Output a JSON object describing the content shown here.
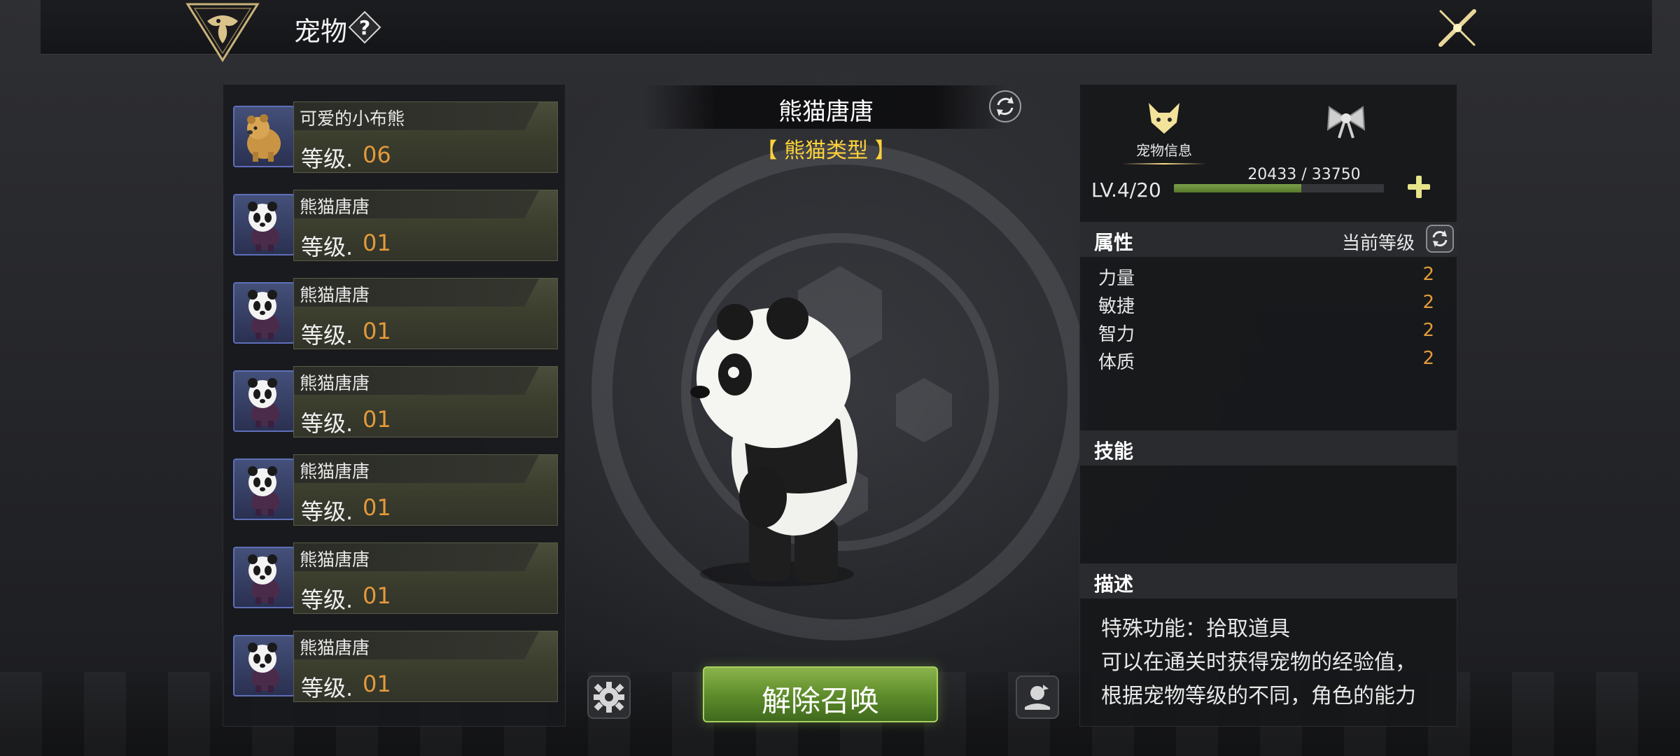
{
  "header": {
    "title": "宠物",
    "help_symbol": "?"
  },
  "pet_list": [
    {
      "name": "可爱的小布熊",
      "level_label": "等级.",
      "level": "06",
      "type": "bear"
    },
    {
      "name": "熊猫唐唐",
      "level_label": "等级.",
      "level": "01",
      "type": "panda"
    },
    {
      "name": "熊猫唐唐",
      "level_label": "等级.",
      "level": "01",
      "type": "panda"
    },
    {
      "name": "熊猫唐唐",
      "level_label": "等级.",
      "level": "01",
      "type": "panda"
    },
    {
      "name": "熊猫唐唐",
      "level_label": "等级.",
      "level": "01",
      "type": "panda"
    },
    {
      "name": "熊猫唐唐",
      "level_label": "等级.",
      "level": "01",
      "type": "panda"
    },
    {
      "name": "熊猫唐唐",
      "level_label": "等级.",
      "level": "01",
      "type": "panda"
    }
  ],
  "selected_pet": {
    "name": "熊猫唐唐",
    "type_label": "【 熊猫类型 】"
  },
  "actions": {
    "dismiss_label": "解除召唤"
  },
  "info": {
    "tabs": [
      {
        "label": "宠物信息",
        "icon": "fox-head-icon",
        "active": true
      },
      {
        "label": "",
        "icon": "bow-icon",
        "active": false
      }
    ],
    "level_text": "LV.4/20",
    "exp_text": "20433 / 33750",
    "exp_fraction": 0.605,
    "attributes_title": "属性",
    "current_level_label": "当前等级",
    "attributes": [
      {
        "name": "力量",
        "value": "2"
      },
      {
        "name": "敏捷",
        "value": "2"
      },
      {
        "name": "智力",
        "value": "2"
      },
      {
        "name": "体质",
        "value": "2"
      }
    ],
    "skills_title": "技能",
    "description_title": "描述",
    "description_lines": [
      "特殊功能：拾取道具",
      "可以在通关时获得宠物的经验值，",
      "根据宠物等级的不同，角色的能力"
    ]
  },
  "colors": {
    "accent_orange": "#e39a3a",
    "type_yellow": "#ffd23a",
    "button_green": "#5c8a2a"
  }
}
